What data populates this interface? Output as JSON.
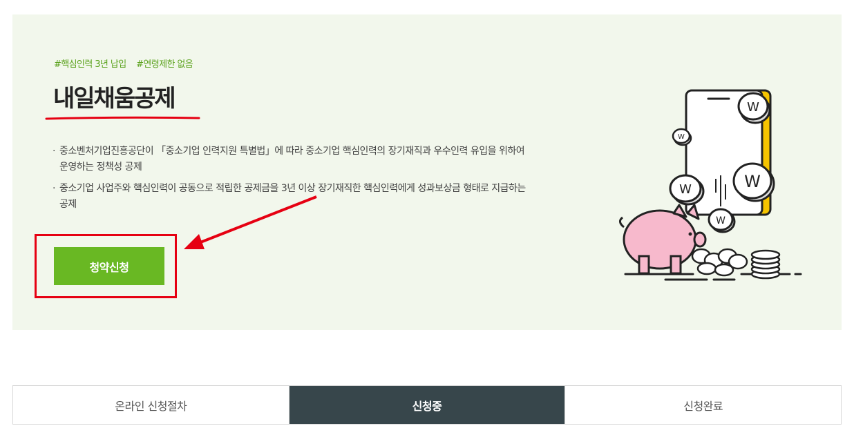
{
  "hero": {
    "tags": [
      "#핵심인력 3년 납입",
      "#연령제한 없음"
    ],
    "title": "내일채움공제",
    "description": [
      "중소벤처기업진흥공단이 「중소기업 인력지원 특별법」에 따라 중소기업 핵심인력의 장기재직과 우수인력 유입을 위하여 운영하는 정책성 공제",
      "중소기업 사업주와 핵심인력이 공동으로 적립한 공제금을 3년 이상 장기재직한 핵심인력에게 성과보상금 형태로 지급하는 공제"
    ],
    "apply_label": "청약신청",
    "accent_color": "#69b823",
    "annotation_color": "#e60012"
  },
  "illustration": {
    "icon": "piggy-bank-phone-coins",
    "coin_symbol": "W"
  },
  "tabs": [
    {
      "label": "온라인 신청절차",
      "active": false
    },
    {
      "label": "신청중",
      "active": true
    },
    {
      "label": "신청완료",
      "active": false
    }
  ]
}
